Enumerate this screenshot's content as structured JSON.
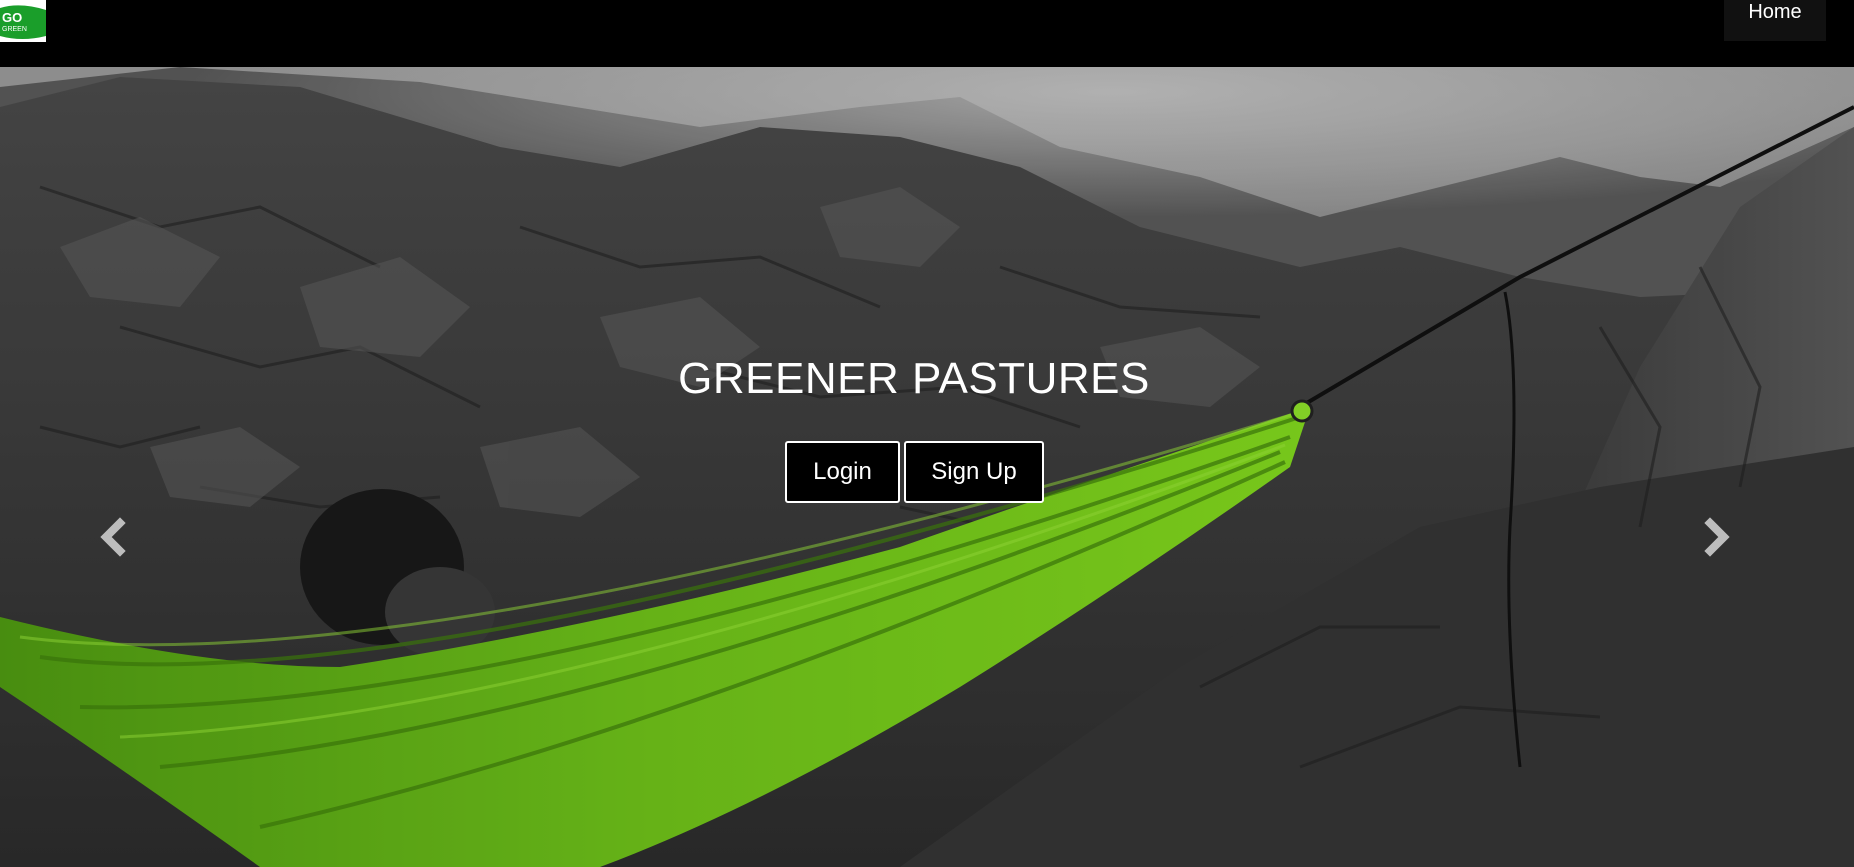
{
  "navbar": {
    "logo_text_top": "GO",
    "logo_text_bottom": "GREEN",
    "home_label": "Home"
  },
  "hero": {
    "title": "GREENER PASTURES",
    "login_label": "Login",
    "signup_label": "Sign Up",
    "prev_icon": "chevron-left-icon",
    "next_icon": "chevron-right-icon"
  },
  "colors": {
    "navbar_bg": "#000000",
    "hammock_green": "#6fc21a",
    "button_bg": "#000000",
    "button_border": "#ffffff",
    "logo_green": "#1a9e2a"
  }
}
